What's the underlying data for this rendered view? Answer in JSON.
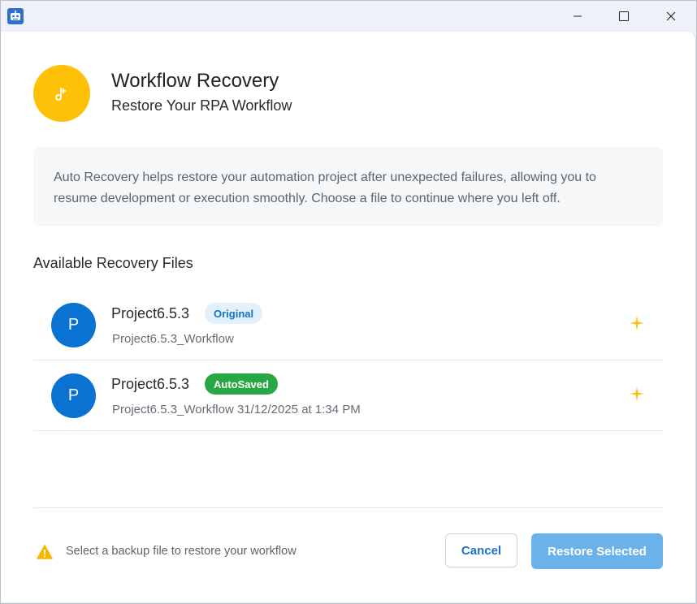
{
  "window": {
    "app_icon": "robot-icon",
    "controls": [
      "minimize-icon",
      "maximize-icon",
      "close-icon"
    ]
  },
  "header": {
    "logo_icon": "sparkle-icon",
    "title": "Workflow Recovery",
    "subtitle": "Restore Your RPA Workflow"
  },
  "info": {
    "text": "Auto Recovery helps restore your automation project after unexpected failures, allowing you to resume development or execution smoothly. Choose a file to continue where you left off."
  },
  "files": {
    "section_title": "Available Recovery Files",
    "items": [
      {
        "avatar": "P",
        "name": "Project6.5.3",
        "badge": "Original",
        "detail": "Project6.5.3_Workflow",
        "action_icon": "sparkle-icon"
      },
      {
        "avatar": "P",
        "name": "Project6.5.3",
        "badge": "AutoSaved",
        "detail": "Project6.5.3_Workflow 31/12/2025 at 1:34 PM",
        "action_icon": "sparkle-icon"
      }
    ]
  },
  "footer": {
    "warning_icon": "warning-icon",
    "hint": "Select a backup file to restore your workflow",
    "cancel_label": "Cancel",
    "restore_label": "Restore Selected"
  },
  "colors": {
    "accent": "#0a73d1",
    "logo": "#ffc107",
    "original_badge": "#e2f0fb",
    "autosaved_badge": "#27a844",
    "restore_button": "#6cb2ea"
  }
}
